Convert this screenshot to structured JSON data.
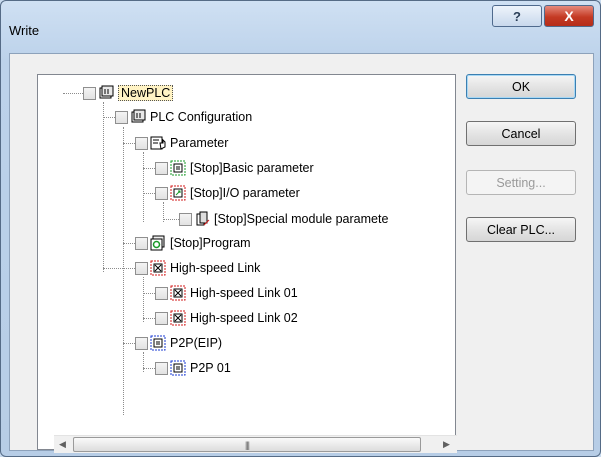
{
  "window": {
    "title": "Write",
    "help_glyph": "?",
    "close_glyph": "X"
  },
  "buttons": {
    "ok": "OK",
    "cancel": "Cancel",
    "setting": "Setting...",
    "clear_plc": "Clear PLC..."
  },
  "tree": {
    "items": [
      {
        "label": "NewPLC",
        "icon": "plc-root-icon",
        "checked": false,
        "selected": true
      },
      {
        "label": "PLC Configuration",
        "icon": "plc-config-icon",
        "checked": false
      },
      {
        "label": "Parameter",
        "icon": "parameter-icon",
        "checked": false
      },
      {
        "label": "[Stop]Basic parameter",
        "icon": "basic-parameter-icon",
        "checked": false
      },
      {
        "label": "[Stop]I/O parameter",
        "icon": "io-parameter-icon",
        "checked": false
      },
      {
        "label": "[Stop]Special module paramete",
        "icon": "special-module-icon",
        "checked": false
      },
      {
        "label": "[Stop]Program",
        "icon": "program-icon",
        "checked": false
      },
      {
        "label": "High-speed Link",
        "icon": "high-speed-link-icon",
        "checked": false
      },
      {
        "label": "High-speed Link 01",
        "icon": "high-speed-link-icon",
        "checked": false
      },
      {
        "label": "High-speed Link 02",
        "icon": "high-speed-link-icon",
        "checked": false
      },
      {
        "label": "P2P(EIP)",
        "icon": "p2p-icon",
        "checked": false
      },
      {
        "label": "P2P 01",
        "icon": "p2p-icon",
        "checked": false
      }
    ]
  },
  "scrollbar": {
    "left_arrow": "◀",
    "right_arrow": "▶",
    "grip": "|||"
  }
}
